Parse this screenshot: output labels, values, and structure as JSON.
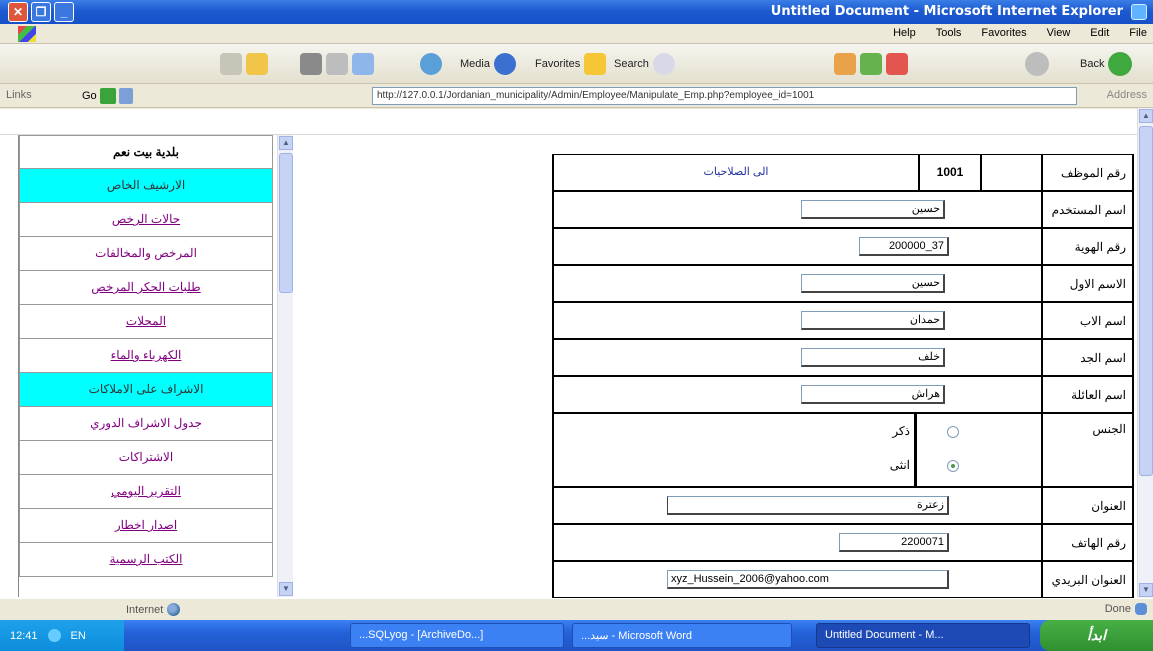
{
  "window": {
    "title": "Untitled Document - Microsoft Internet Explorer",
    "close_glyph": "✕",
    "max_glyph": "❐",
    "min_glyph": "_"
  },
  "menubar": {
    "items": [
      "Help",
      "Tools",
      "Favorites",
      "View",
      "Edit",
      "File"
    ]
  },
  "toolbar": {
    "media_label": "Media",
    "favorites_label": "Favorites",
    "search_label": "Search",
    "back_label": "Back"
  },
  "addressbar": {
    "links_label": "Links",
    "go_label": "Go",
    "url": "http://127.0.0.1/Jordanian_municipality/Admin/Employee/Manipulate_Emp.php?employee_id=1001",
    "address_label": "Address"
  },
  "sidebar": {
    "items": [
      {
        "label": "بلدية بيت نعم",
        "style": "head"
      },
      {
        "label": "الارشيف الخاص",
        "style": "cyan"
      },
      {
        "label": "حالات الرخص",
        "style": "link"
      },
      {
        "label": "المرخص والمخالفات",
        "style": "plain"
      },
      {
        "label": "طلبات الحكر المرخص",
        "style": "link"
      },
      {
        "label": "المحلات",
        "style": "link"
      },
      {
        "label": "الكهرباء والماء",
        "style": "link"
      },
      {
        "label": "الاشراف على الاملاكات",
        "style": "cyan"
      },
      {
        "label": "جدول الاشراف الدوري",
        "style": "plain"
      },
      {
        "label": "الاشتراكات",
        "style": "plain"
      },
      {
        "label": "التقرير اليومي",
        "style": "link"
      },
      {
        "label": "اصدار اخطار",
        "style": "link"
      },
      {
        "label": "الكتب الرسمية",
        "style": "link"
      }
    ]
  },
  "form": {
    "employee_id_label": "رقم الموظف",
    "employee_id_value": "1001",
    "permissions_link": "الى الصلاحيات",
    "username_label": "اسم المستخدم",
    "username_value": "حسين",
    "id_number_label": "رقم الهوية",
    "id_number_value": "200000_37",
    "first_name_label": "الاسم الاول",
    "first_name_value": "حسين",
    "father_name_label": "اسم الاب",
    "father_name_value": "حمدان",
    "grandfather_name_label": "اسم الجد",
    "grandfather_name_value": "خلف",
    "family_name_label": "اسم العائلة",
    "family_name_value": "هراش",
    "gender_label": "الجنس",
    "gender_male": "ذكر",
    "gender_female": "انثى",
    "address_label": "العنوان",
    "address_value": "زعترة",
    "phone_label": "رقم الهاتف",
    "phone_value": "2200071",
    "email_label": "العنوان البريدي",
    "email_value": "xyz_Hussein_2006@yahoo.com"
  },
  "statusbar": {
    "left": "Internet",
    "right": "Done"
  },
  "taskbar": {
    "clock": "12:41",
    "lang": "EN",
    "tasks": [
      "...SQLyog - [ArchiveDo...]",
      "...سيد - Microsoft Word",
      "Untitled Document - M..."
    ],
    "start": "ابدأ"
  }
}
